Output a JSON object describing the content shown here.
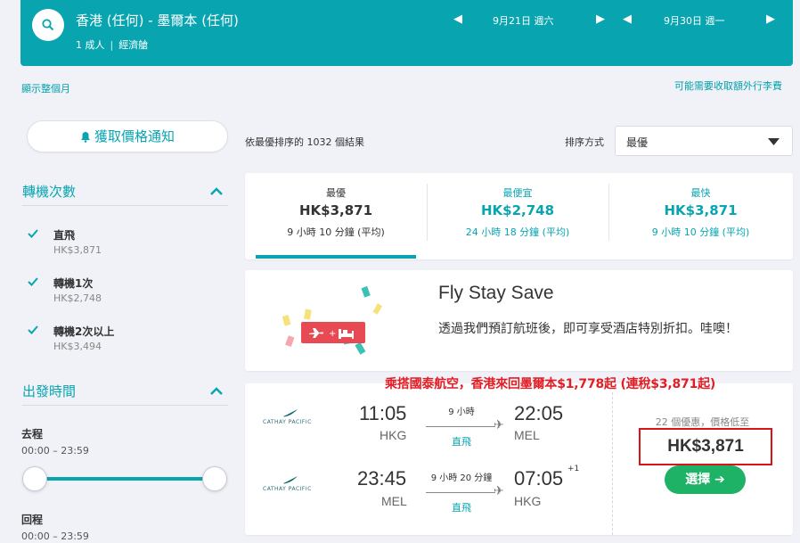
{
  "search": {
    "route": "香港 (任何) - 墨爾本 (任何)",
    "passengers": "1 成人",
    "cabin": "經濟艙",
    "depart_date": "9月21日 週六",
    "return_date": "9月30日 週一"
  },
  "links": {
    "show_month": "顯示整個月",
    "extra_fees": "可能需要收取額外行李費"
  },
  "sidebar": {
    "price_alert": "獲取價格通知",
    "stops_title": "轉機次數",
    "stops": [
      {
        "label": "直飛",
        "price": "HK$3,871",
        "checked": true
      },
      {
        "label": "轉機1次",
        "price": "HK$2,748",
        "checked": true
      },
      {
        "label": "轉機2次以上",
        "price": "HK$3,494",
        "checked": true
      }
    ],
    "departure_title": "出發時間",
    "outbound_label": "去程",
    "outbound_range": "00:00 – 23:59",
    "return_label": "回程",
    "return_range": "00:00 – 23:59"
  },
  "results": {
    "count_text": "依最優排序的 1032 個結果",
    "sort_label": "排序方式",
    "sort_value": "最優"
  },
  "sort_tabs": [
    {
      "title": "最優",
      "price": "HK$3,871",
      "duration": "9 小時 10 分鐘 (平均)",
      "active": true
    },
    {
      "title": "最便宜",
      "price": "HK$2,748",
      "duration": "24 小時 18 分鐘 (平均)",
      "active": false
    },
    {
      "title": "最快",
      "price": "HK$3,871",
      "duration": "9 小時 10 分鐘 (平均)",
      "active": false
    }
  ],
  "promo": {
    "title": "Fly Stay Save",
    "text": "透過我們預訂航班後，即可享受酒店特別折扣。哇噢！"
  },
  "annotation": "乘搭國泰航空，香港來回墨爾本$1,778起 (連稅$3,871起)",
  "flight": {
    "airline": "CATHAY PACIFIC",
    "outbound": {
      "dep_time": "11:05",
      "dep_code": "HKG",
      "duration": "9 小時",
      "arr_time": "22:05",
      "arr_code": "MEL",
      "stops": "直飛"
    },
    "inbound": {
      "dep_time": "23:45",
      "dep_code": "MEL",
      "duration": "9 小時 20 分鐘",
      "arr_time": "07:05",
      "arr_day_offset": "+1",
      "arr_code": "HKG",
      "stops": "直飛"
    },
    "deals_text": "22 個優惠，價格低至",
    "price": "HK$3,871",
    "select_label": "選擇 ➔"
  },
  "colors": {
    "brand": "#08a5b1",
    "select_button": "#1eb266",
    "annotation": "#e21d24",
    "background": "#f1f2f8"
  }
}
